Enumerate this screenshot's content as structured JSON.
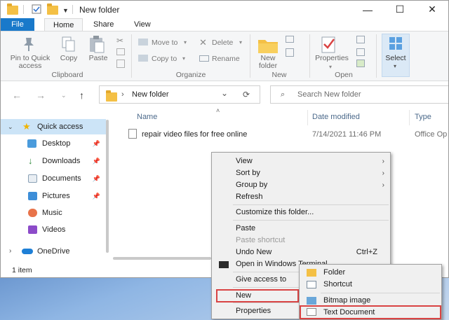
{
  "window": {
    "title": "New folder",
    "controls": {
      "minimize": "—",
      "maximize": "☐",
      "close": "✕"
    }
  },
  "tabs": [
    "File",
    "Home",
    "Share",
    "View"
  ],
  "ribbon": {
    "clipboard": {
      "pin_label_1": "Pin to Quick",
      "pin_label_2": "access",
      "copy": "Copy",
      "paste": "Paste",
      "group": "Clipboard"
    },
    "organize": {
      "move_to": "Move to",
      "copy_to": "Copy to",
      "delete": "Delete",
      "rename": "Rename",
      "group": "Organize"
    },
    "new": {
      "new_folder_1": "New",
      "new_folder_2": "folder",
      "group": "New"
    },
    "open": {
      "properties": "Properties",
      "group": "Open"
    },
    "select": {
      "select": "Select"
    }
  },
  "address": {
    "path": "New folder",
    "search_placeholder": "Search New folder"
  },
  "nav": {
    "quick_access": "Quick access",
    "items": [
      "Desktop",
      "Downloads",
      "Documents",
      "Pictures",
      "Music",
      "Videos"
    ],
    "onedrive": "OneDrive"
  },
  "columns": {
    "name": "Name",
    "date": "Date modified",
    "type": "Type"
  },
  "files": [
    {
      "name": "repair video files for free online",
      "date": "7/14/2021 11:46 PM",
      "type": "Office Op"
    }
  ],
  "status": {
    "count": "1 item"
  },
  "context_menu": {
    "view": "View",
    "sort_by": "Sort by",
    "group_by": "Group by",
    "refresh": "Refresh",
    "customize": "Customize this folder...",
    "paste": "Paste",
    "paste_shortcut": "Paste shortcut",
    "undo_new": "Undo New",
    "undo_shortcut": "Ctrl+Z",
    "open_terminal": "Open in Windows Terminal",
    "give_access": "Give access to",
    "new": "New",
    "properties": "Properties"
  },
  "new_submenu": {
    "folder": "Folder",
    "shortcut": "Shortcut",
    "bitmap": "Bitmap image",
    "text_document": "Text Document"
  },
  "colors": {
    "accent": "#1979ca",
    "selection": "#cce4f7",
    "highlight_box": "#d94343",
    "folder": "#f4c045"
  }
}
